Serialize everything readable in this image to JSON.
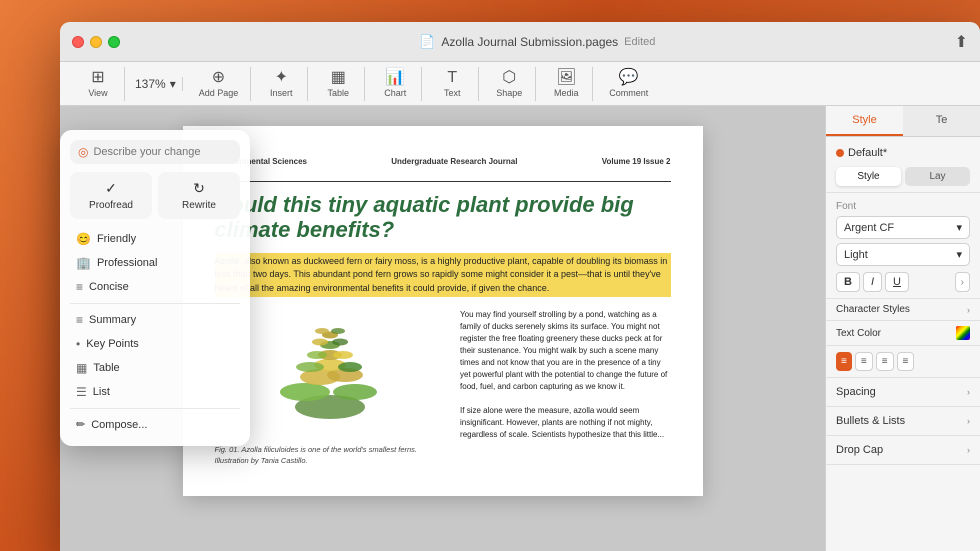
{
  "window": {
    "title": "Azolla Journal Submission.pages",
    "edited_label": "Edited",
    "doc_icon": "📄"
  },
  "toolbar": {
    "view_label": "View",
    "zoom_value": "137%",
    "zoom_icon": "▾",
    "add_page_label": "Add Page",
    "insert_label": "Insert",
    "table_label": "Table",
    "chart_label": "Chart",
    "text_label": "Text",
    "shape_label": "Shape",
    "media_label": "Media",
    "comment_label": "Comment",
    "share_label": "Share"
  },
  "ai_panel": {
    "search_placeholder": "Describe your change",
    "proofread_label": "Proofread",
    "rewrite_label": "Rewrite",
    "menu": [
      {
        "icon": "😊",
        "label": "Friendly"
      },
      {
        "icon": "🏢",
        "label": "Professional"
      },
      {
        "icon": "≡",
        "label": "Concise"
      }
    ],
    "divider": true,
    "actions": [
      {
        "icon": "≡",
        "label": "Summary"
      },
      {
        "icon": "•",
        "label": "Key Points"
      },
      {
        "icon": "▦",
        "label": "Table"
      },
      {
        "icon": "☰",
        "label": "List"
      }
    ],
    "compose_label": "Compose..."
  },
  "document": {
    "header": {
      "col1_label": "Environmental Sciences",
      "col2_label": "Undergraduate Research Journal",
      "col3_label": "Volume 19 Issue 2"
    },
    "title": "Could this tiny aquatic plant provide big climate benefits?",
    "highlight": "Azolla, also known as duckweed fern or fairy moss, is a highly productive plant, capable of doubling its biomass in less than two days. This abundant pond fern grows so rapidly some might consider it a pest—that is until they've heard of all the amazing environmental benefits it could provide, if given the chance.",
    "fig_caption": "Fig. 01. Azolla filiculoides is one of the world's smallest ferns. Illustration by Tania Castillo.",
    "body_text": "You may find yourself strolling by a pond, watching as a family of ducks serenely skims its surface. You might not register the free floating greenery these ducks peck at for their sustenance. You might walk by such a scene many times and not know that you are in the presence of a tiny yet powerful plant with the potential to change the future of food, fuel, and carbon capturing as we know it.\n\nIf size alone were the measure, azolla would seem insignificant. However, plants are nothing if not mighty, regardless of scale. Scientists hypothesize that this little..."
  },
  "right_panel": {
    "tabs": [
      {
        "label": "Style",
        "active": true
      },
      {
        "label": "Te",
        "active": false
      }
    ],
    "style_section": {
      "default_label": "Default*",
      "sub_tabs": [
        {
          "label": "Style",
          "active": true
        },
        {
          "label": "Lay",
          "active": false
        }
      ]
    },
    "font_section": {
      "label": "Font",
      "name": "Argent CF",
      "weight": "Light",
      "formats": [
        "B",
        "I",
        "U"
      ],
      "more": "›"
    },
    "char_styles_label": "Character Styles",
    "text_color_label": "Text Color",
    "alignment": {
      "options": [
        "left",
        "center",
        "right",
        "justify"
      ],
      "active": "left"
    },
    "spacing_label": "Spacing",
    "bullets_label": "Bullets & Lists",
    "drop_cap_label": "Drop Cap"
  }
}
